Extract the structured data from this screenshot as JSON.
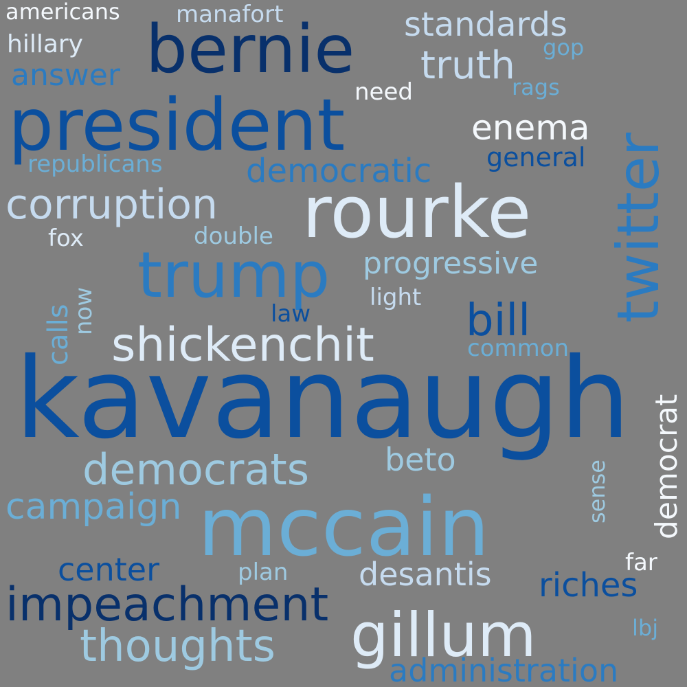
{
  "background": "#808080",
  "palette": {
    "navy": "#08306b",
    "dark_blue": "#0b4f9e",
    "blue": "#2b7bc1",
    "mid_blue": "#6baed6",
    "light_blue": "#9ecae1",
    "pale_blue": "#c6dbef",
    "white": "#f4f8fc"
  },
  "words": [
    {
      "text": "kavanaugh",
      "color": "#0b4f9e"
    },
    {
      "text": "mccain",
      "color": "#6baed6"
    },
    {
      "text": "president",
      "color": "#0b4f9e"
    },
    {
      "text": "rourke",
      "color": "#deebf7"
    },
    {
      "text": "bernie",
      "color": "#08306b"
    },
    {
      "text": "trump",
      "color": "#2b7bc1"
    },
    {
      "text": "twitter",
      "color": "#2b7bc1"
    },
    {
      "text": "gillum",
      "color": "#deebf7"
    },
    {
      "text": "impeachment",
      "color": "#08306b"
    },
    {
      "text": "shickenchit",
      "color": "#deebf7"
    },
    {
      "text": "thoughts",
      "color": "#9ecae1"
    },
    {
      "text": "democrats",
      "color": "#9ecae1"
    },
    {
      "text": "corruption",
      "color": "#c6dbef"
    },
    {
      "text": "bill",
      "color": "#0b4f9e"
    },
    {
      "text": "administration",
      "color": "#2b7bc1"
    },
    {
      "text": "campaign",
      "color": "#6baed6"
    },
    {
      "text": "democratic",
      "color": "#2b7bc1"
    },
    {
      "text": "progressive",
      "color": "#9ecae1"
    },
    {
      "text": "desantis",
      "color": "#c6dbef"
    },
    {
      "text": "standards",
      "color": "#c6dbef"
    },
    {
      "text": "truth",
      "color": "#c6dbef"
    },
    {
      "text": "center",
      "color": "#0b4f9e"
    },
    {
      "text": "riches",
      "color": "#0b4f9e"
    },
    {
      "text": "enema",
      "color": "#f4f8fc"
    },
    {
      "text": "democrat",
      "color": "#f4f8fc"
    },
    {
      "text": "beto",
      "color": "#9ecae1"
    },
    {
      "text": "answer",
      "color": "#2b7bc1"
    },
    {
      "text": "republicans",
      "color": "#6baed6"
    },
    {
      "text": "general",
      "color": "#0b4f9e"
    },
    {
      "text": "calls",
      "color": "#6baed6"
    },
    {
      "text": "americans",
      "color": "#f4f8fc"
    },
    {
      "text": "manafort",
      "color": "#c6dbef"
    },
    {
      "text": "hillary",
      "color": "#deebf7"
    },
    {
      "text": "need",
      "color": "#f4f8fc"
    },
    {
      "text": "double",
      "color": "#9ecae1"
    },
    {
      "text": "common",
      "color": "#6baed6"
    },
    {
      "text": "plan",
      "color": "#9ecae1"
    },
    {
      "text": "fox",
      "color": "#deebf7"
    },
    {
      "text": "light",
      "color": "#c6dbef"
    },
    {
      "text": "law",
      "color": "#0b4f9e"
    },
    {
      "text": "now",
      "color": "#9ecae1"
    },
    {
      "text": "far",
      "color": "#f4f8fc"
    },
    {
      "text": "sense",
      "color": "#9ecae1"
    },
    {
      "text": "gop",
      "color": "#6baed6"
    },
    {
      "text": "rags",
      "color": "#6baed6"
    },
    {
      "text": "lbj",
      "color": "#6baed6"
    }
  ]
}
